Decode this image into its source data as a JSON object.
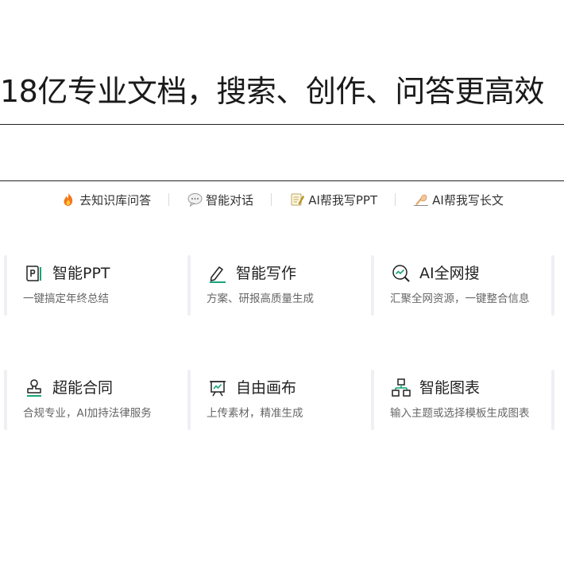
{
  "hero": {
    "title": "18亿专业文档，搜索、创作、问答更高效"
  },
  "quick_links": [
    {
      "icon": "fire-icon",
      "label": "去知识库问答"
    },
    {
      "icon": "speech-bubble-icon",
      "label": "智能对话"
    },
    {
      "icon": "memo-icon",
      "label": "AI帮我写PPT"
    },
    {
      "icon": "writing-hand-icon",
      "label": "AI帮我写长文"
    }
  ],
  "features": [
    {
      "icon": "ppt-icon",
      "title": "智能PPT",
      "desc": "一键搞定年终总结"
    },
    {
      "icon": "pen-icon",
      "title": "智能写作",
      "desc": "方案、研报高质量生成"
    },
    {
      "icon": "search-icon",
      "title": "AI全网搜",
      "desc": "汇聚全网资源，一键整合信息"
    },
    {
      "icon": "stamp-icon",
      "title": "超能合同",
      "desc": "合规专业，AI加持法律服务"
    },
    {
      "icon": "canvas-icon",
      "title": "自由画布",
      "desc": "上传素材，精准生成"
    },
    {
      "icon": "org-chart-icon",
      "title": "智能图表",
      "desc": "输入主题或选择模板生成图表"
    }
  ],
  "colors": {
    "accent": "#19a57a",
    "text": "#222222",
    "muted": "#666666"
  }
}
